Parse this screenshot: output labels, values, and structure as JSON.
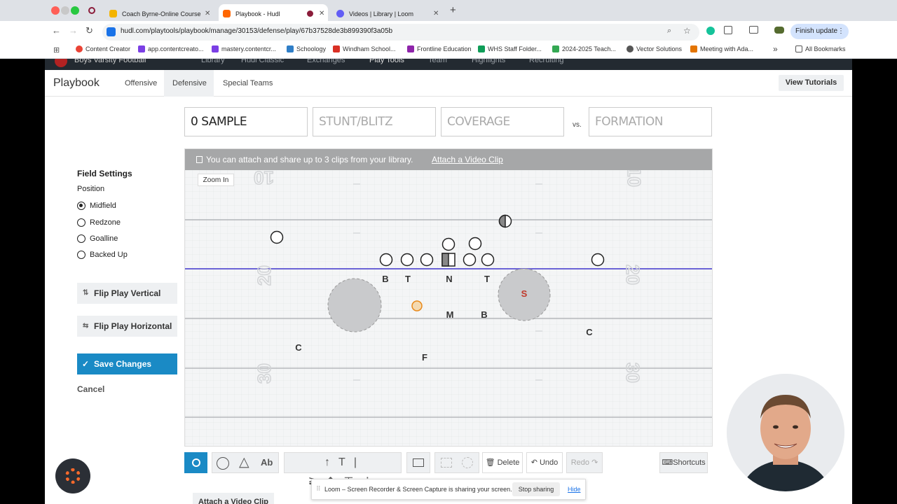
{
  "browser": {
    "tabs": [
      {
        "title": "Coach Byrne-Online Course"
      },
      {
        "title": "Playbook - Hudl"
      },
      {
        "title": "Videos | Library | Loom"
      }
    ],
    "new_tab": "+",
    "url": "hudl.com/playtools/playbook/manage/30153/defense/play/67b37528de3b899390f3a05b",
    "finish_update": "Finish update",
    "bookmarks": [
      "Content Creator",
      "app.contentcreato...",
      "mastery.contentcr...",
      "Schoology",
      "Windham School...",
      "Frontline Education",
      "WHS Staff Folder...",
      "2024-2025 Teach...",
      "Vector Solutions",
      "Meeting with Ada..."
    ],
    "more_bookmarks": "»",
    "all_bookmarks": "All Bookmarks"
  },
  "hudl_nav": {
    "team": "Boys Varsity Football",
    "items": [
      "Library",
      "Hudl Classic",
      "Exchanges",
      "Play Tools",
      "Team",
      "Highlights",
      "Recruiting"
    ]
  },
  "app": {
    "title": "Playbook",
    "tabs": [
      "Offensive",
      "Defensive",
      "Special Teams"
    ],
    "active_tab": "Defensive",
    "view_tutorials": "View Tutorials"
  },
  "play_fields": {
    "name": "0 SAMPLE",
    "stunt_placeholder": "STUNT/BLITZ",
    "coverage_placeholder": "COVERAGE",
    "vs": "vs.",
    "formation_placeholder": "FORMATION"
  },
  "field_settings": {
    "heading": "Field Settings",
    "position_label": "Position",
    "options": [
      "Midfield",
      "Redzone",
      "Goalline",
      "Backed Up"
    ],
    "selected": "Midfield",
    "flip_vertical": "Flip Play Vertical",
    "flip_horizontal": "Flip Play Horizontal",
    "save": "Save Changes",
    "cancel": "Cancel"
  },
  "field": {
    "clip_message": "You can attach and share up to 3 clips from your library.",
    "attach_link": "Attach a Video Clip",
    "zoom_in": "Zoom In",
    "yard_numbers": [
      "10",
      "20",
      "30"
    ],
    "player_labels": [
      "B",
      "T",
      "N",
      "T",
      "S",
      "M",
      "B",
      "C",
      "C",
      "F"
    ]
  },
  "tools": {
    "delete": "Delete",
    "undo": "Undo",
    "redo": "Redo",
    "shortcuts": "Shortcuts",
    "text_tool": "Ab"
  },
  "below_field": {
    "attach": "Attach a Video Clip"
  },
  "loom": {
    "message": "Loom – Screen Recorder & Screen Capture is sharing your screen.",
    "stop": "Stop sharing",
    "hide": "Hide"
  },
  "colors": {
    "save_blue": "#1a8ac5",
    "los_purple": "#6b63d6",
    "safety_red": "#c0392b"
  }
}
